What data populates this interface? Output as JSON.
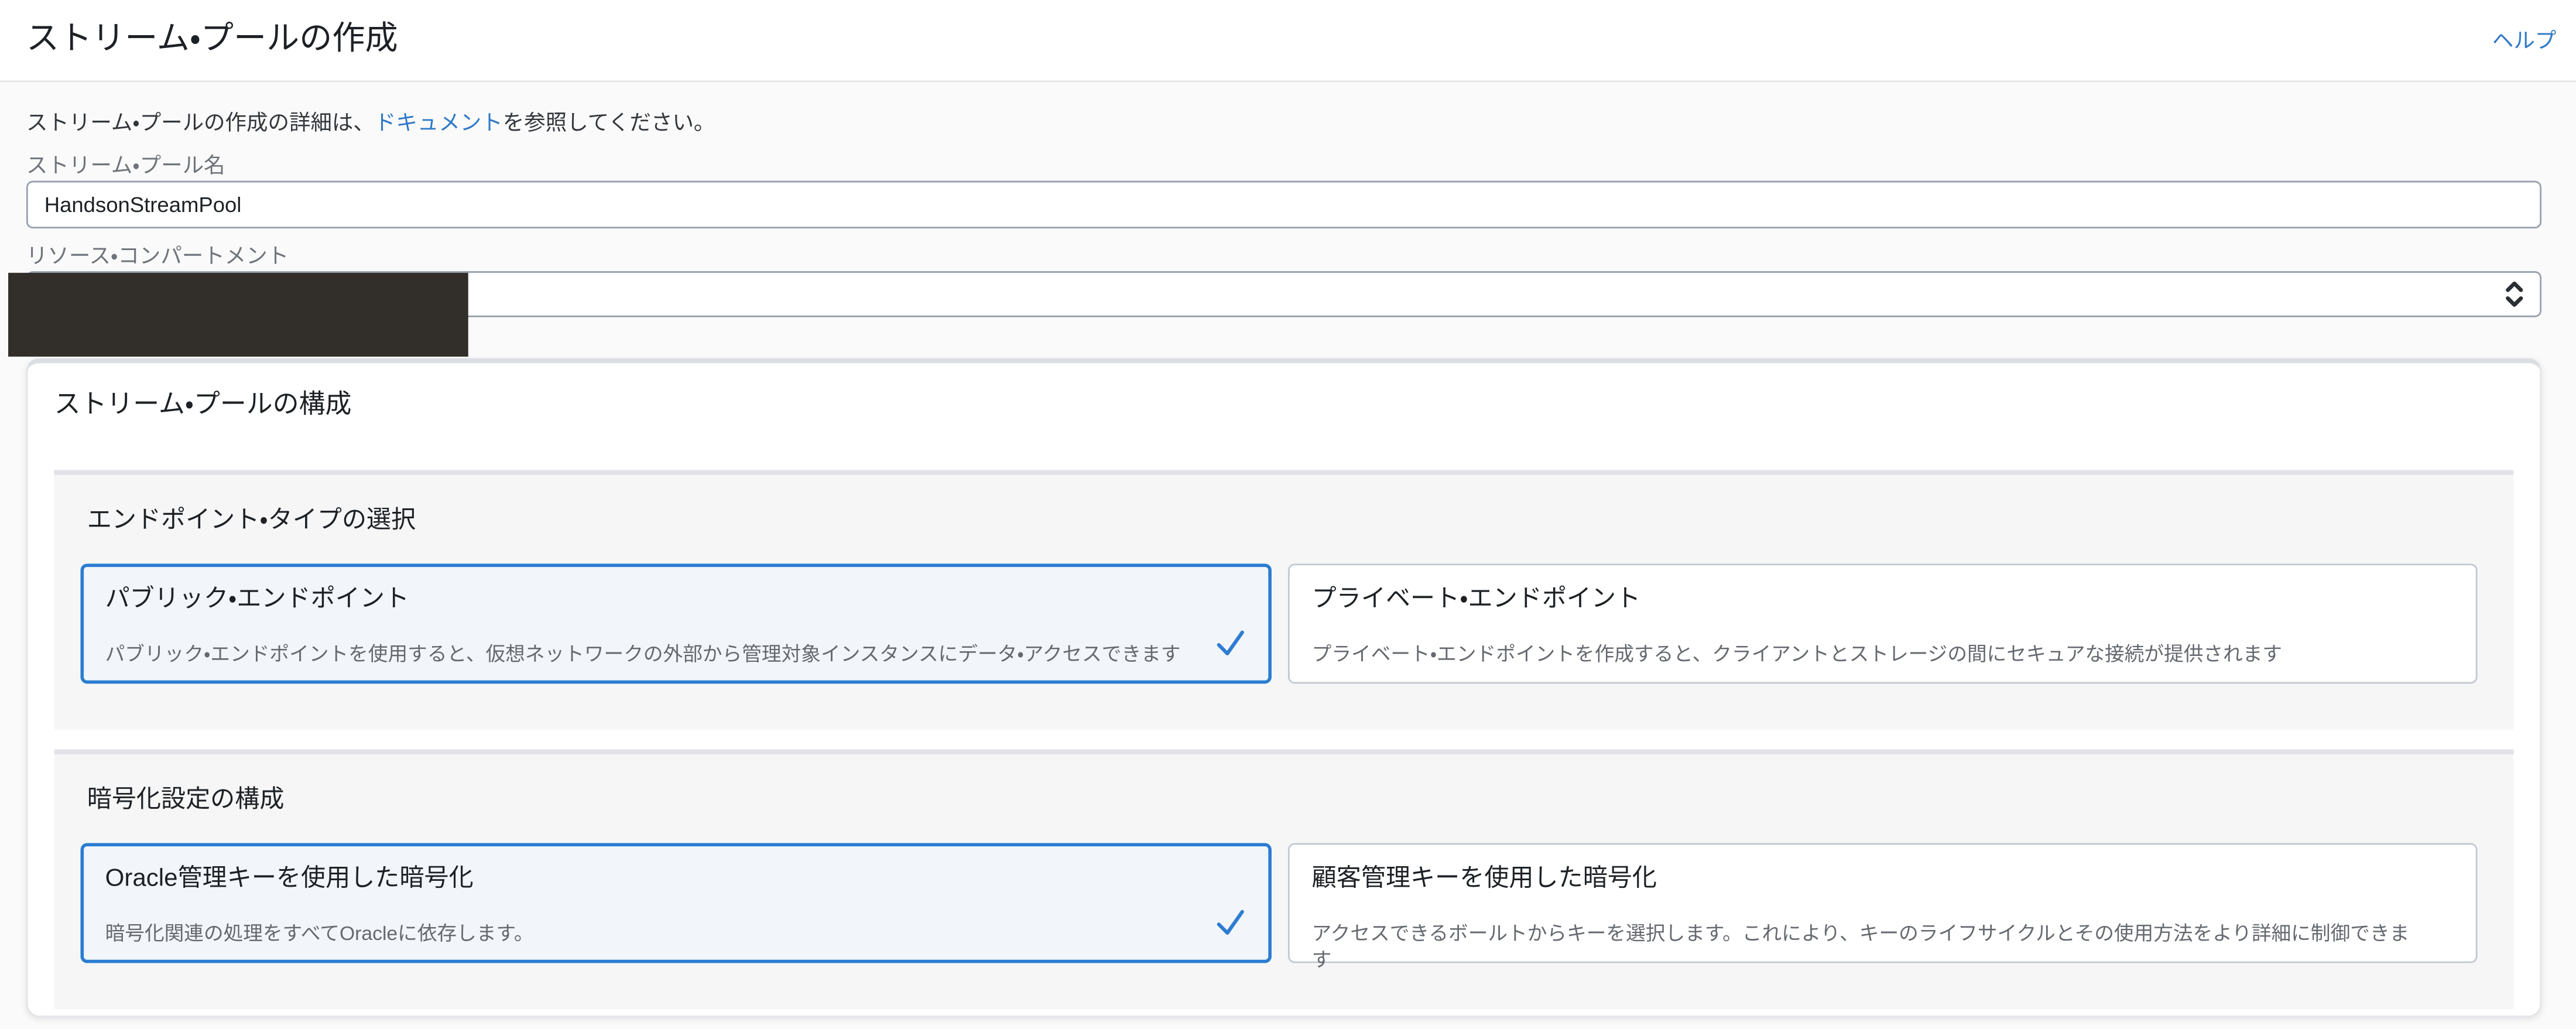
{
  "page": {
    "title": "ストリーム・プールの作成",
    "help_link": "ヘルプ",
    "intro": {
      "pre": "ストリーム・プールの作成の詳細は、",
      "link": "ドキュメント",
      "post": "を参照してください。"
    },
    "fields": {
      "name_label": "ストリーム・プール名",
      "name_value": "HandsonStreamPool",
      "compartment_label": "リソース・コンパートメント"
    },
    "config_section": {
      "title": "ストリーム・プールの構成",
      "endpoint": {
        "title": "エンドポイント・タイプの選択",
        "options": [
          {
            "title": "パブリック・エンドポイント",
            "description": "パブリック・エンドポイントを使用すると、仮想ネットワークの外部から管理対象インスタンスにデータ・アクセスできます",
            "selected": true
          },
          {
            "title": "プライベート・エンドポイント",
            "description": "プライベート・エンドポイントを作成すると、クライアントとストレージの間にセキュアな接続が提供されます",
            "selected": false
          }
        ]
      },
      "encryption": {
        "title": "暗号化設定の構成",
        "options": [
          {
            "title": "Oracle管理キーを使用した暗号化",
            "description": "暗号化関連の処理をすべてOracleに依存します。",
            "selected": true
          },
          {
            "title": "顧客管理キーを使用した暗号化",
            "description": "アクセスできるボールトからキーを選択します。これにより、キーのライフサイクルとその使用方法をより詳細に制御できます",
            "selected": false
          }
        ]
      }
    },
    "colors": {
      "accent_blue": "#2a7dd1",
      "link_blue": "#2e79c7",
      "check_blue": "#2f7cd2",
      "redaction_black": "#322f2b"
    }
  }
}
